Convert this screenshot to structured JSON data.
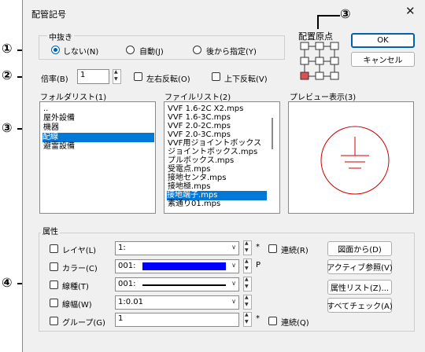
{
  "title": "配管記号",
  "callouts": [
    "①",
    "②",
    "③",
    "③",
    "④"
  ],
  "nukiGroup": {
    "label": "中抜き",
    "options": [
      "しない(N)",
      "自動(J)",
      "後から指定(Y)"
    ],
    "selected": 0
  },
  "haichiGenten": {
    "label": "配置原点"
  },
  "buttons": {
    "ok": "OK",
    "cancel": "キャンセル"
  },
  "scale": {
    "label": "倍率(B)",
    "value": "1",
    "flipH": "左右反転(O)",
    "flipV": "上下反転(V)"
  },
  "folderList": {
    "label": "フォルダリスト(1)",
    "items": [
      "..",
      "屋外設備",
      "機器",
      "配線",
      "避雷設備"
    ],
    "selected": 3
  },
  "fileList": {
    "label": "ファイルリスト(2)",
    "items": [
      "VVF 1.6-2C X2.mps",
      "VVF 1.6-3C.mps",
      "VVF 2.0-2C.mps",
      "VVF 2.0-3C.mps",
      "VVF用ジョイントボックス",
      "ジョイントボックス.mps",
      "プルボックス.mps",
      "受電点.mps",
      "接地センタ.mps",
      "接地極.mps",
      "接地端子.mps",
      "素通り01.mps"
    ],
    "selected": 10
  },
  "preview": {
    "label": "プレビュー表示(3)"
  },
  "attributes": {
    "label": "属性",
    "rows": [
      {
        "label": "レイヤ(L)",
        "value": "1:",
        "extra": "*",
        "checkbox2": "連続(R)"
      },
      {
        "label": "カラー(C)",
        "value": "001:",
        "extra": "P",
        "checkbox2": ""
      },
      {
        "label": "線種(T)",
        "value": "001:",
        "extra": "",
        "checkbox2": ""
      },
      {
        "label": "線幅(W)",
        "value": "1:0.01",
        "extra": "",
        "checkbox2": ""
      },
      {
        "label": "グループ(G)",
        "value": "1",
        "extra": "*",
        "checkbox2": "連続(Q)"
      }
    ],
    "buttons": [
      "図面から(D)",
      "アクティブ参照(V)",
      "属性リスト(Z)...",
      "すべてチェック(A)"
    ]
  },
  "colors": {
    "accent": "#0078d7",
    "swatch": "#0000ff",
    "preview": "#cc0000"
  }
}
